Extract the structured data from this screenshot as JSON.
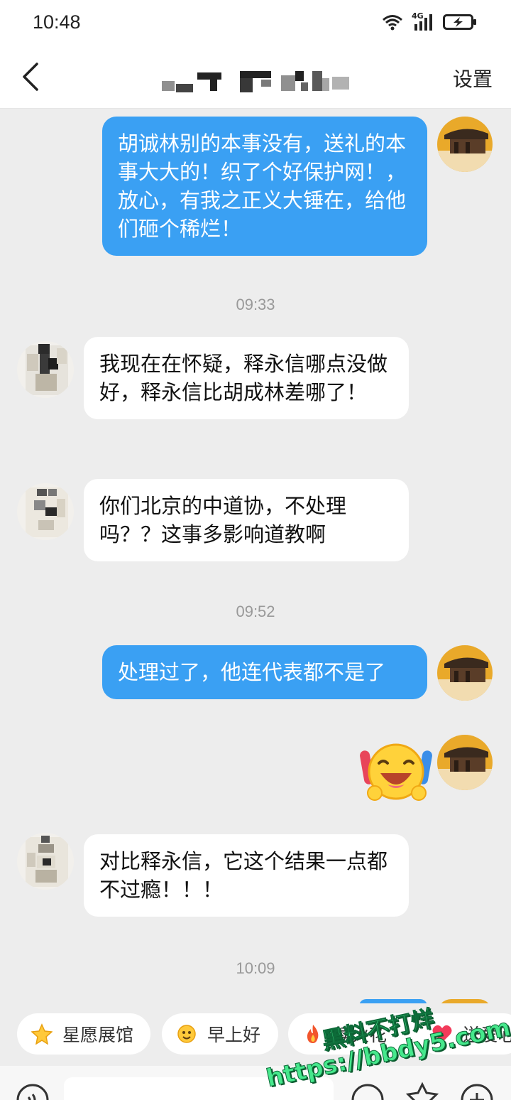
{
  "status_bar": {
    "time": "10:48",
    "network": "4G"
  },
  "header": {
    "settings_label": "设置"
  },
  "messages": [
    {
      "text": "胡诚林别的本事没有，送礼的本事大大的！织了个好保护网！，放心，有我之正义大锤在，给他们砸个稀烂！"
    },
    {
      "timestamp": "09:33"
    },
    {
      "text": "我现在在怀疑，释永信哪点没做好，释永信比胡成林差哪了！"
    },
    {
      "text": "你们北京的中道协，不处理吗？？这事多影响道教啊"
    },
    {
      "timestamp": "09:52"
    },
    {
      "text": "处理过了，他连代表都不是了"
    },
    {
      "sticker": "laughing-emoji-sticker"
    },
    {
      "text": "对比释永信，它这个结果一点都不过瘾！！！"
    },
    {
      "timestamp": "10:09"
    }
  ],
  "quick_replies": [
    {
      "label": "星愿展馆",
      "icon": "star-icon"
    },
    {
      "label": "早上好",
      "icon": "sun-emoji-icon"
    },
    {
      "label": "续火花",
      "icon": "fire-icon"
    },
    {
      "label": "送爱心",
      "icon": "heart-icon"
    }
  ],
  "watermark": {
    "line1": "黑料不打烊",
    "line2": "https://bbdy5.com"
  },
  "colors": {
    "outgoing_bubble": "#3aa0f3",
    "incoming_bubble": "#ffffff",
    "background": "#ededed",
    "watermark": "#46e88c"
  }
}
